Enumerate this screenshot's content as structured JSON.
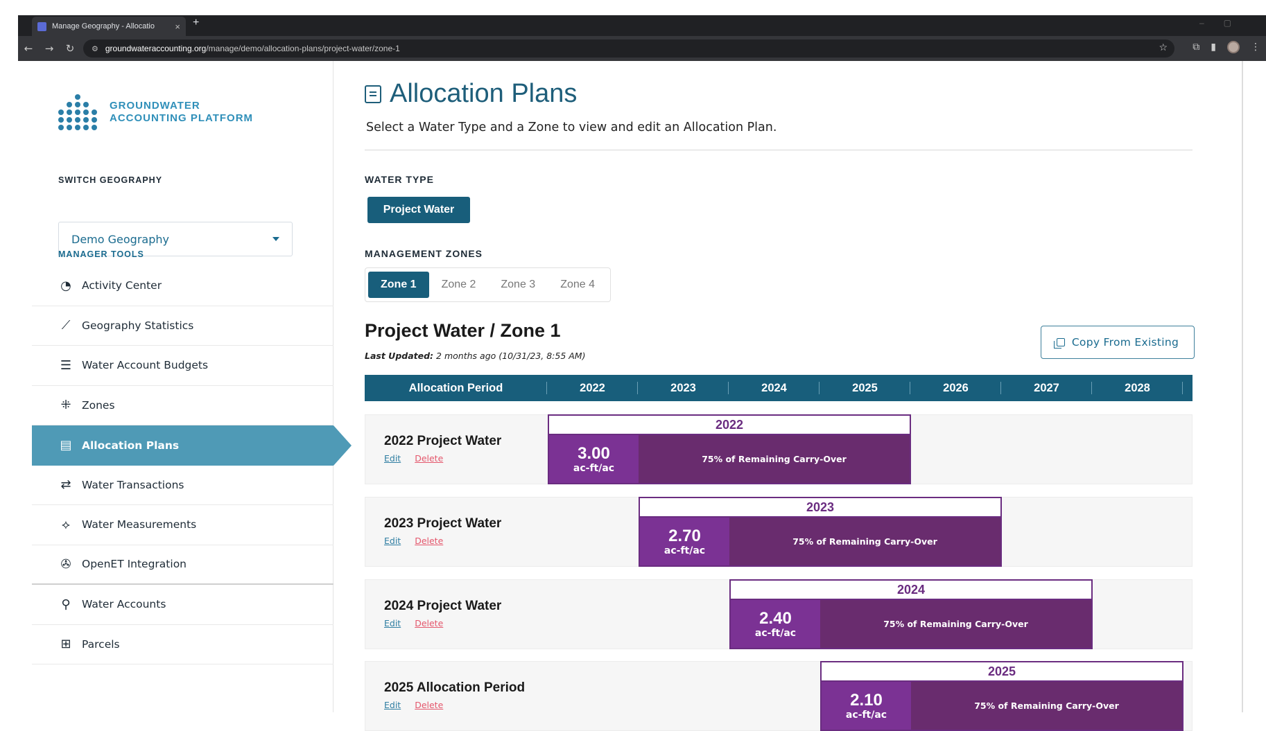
{
  "browser": {
    "tab_title": "Manage Geography - Allocatio",
    "tab_close": "×",
    "new_tab": "+",
    "url_host": "groundwateraccounting.org",
    "url_path": "/manage/demo/allocation-plans/project-water/zone-1"
  },
  "sidebar": {
    "logo_line1": "GROUNDWATER",
    "logo_line2": "ACCOUNTING PLATFORM",
    "switch_label": "SWITCH GEOGRAPHY",
    "geography_value": "Demo Geography",
    "manager_tools_label": "MANAGER TOOLS",
    "items": [
      {
        "label": "Activity Center",
        "icon": "gauge-icon"
      },
      {
        "label": "Geography Statistics",
        "icon": "line-chart-icon"
      },
      {
        "label": "Water Account Budgets",
        "icon": "budget-list-icon"
      },
      {
        "label": "Zones",
        "icon": "zones-icon"
      },
      {
        "label": "Allocation Plans",
        "icon": "allocation-plan-icon",
        "active": true
      },
      {
        "label": "Water Transactions",
        "icon": "transfer-arrows-icon"
      },
      {
        "label": "Water Measurements",
        "icon": "ruler-icon"
      },
      {
        "label": "OpenET Integration",
        "icon": "satellite-icon"
      },
      {
        "label": "Water Accounts",
        "icon": "irrigation-icon"
      },
      {
        "label": "Parcels",
        "icon": "grid-icon"
      }
    ]
  },
  "main": {
    "title": "Allocation Plans",
    "subtitle": "Select a Water Type and a Zone to view and edit an Allocation Plan.",
    "water_type_label": "WATER TYPE",
    "water_type_selected": "Project Water",
    "management_zones_label": "MANAGEMENT ZONES",
    "zones": [
      "Zone 1",
      "Zone 2",
      "Zone 3",
      "Zone 4"
    ],
    "selected_zone": "Zone 1",
    "plan_title": "Project Water / Zone 1",
    "last_updated_label": "Last Updated:",
    "last_updated_value": "2 months ago (10/31/23, 8:55 AM)",
    "copy_button": "Copy From Existing",
    "timeline_header": {
      "period_label": "Allocation Period",
      "years": [
        "2022",
        "2023",
        "2024",
        "2025",
        "2026",
        "2027",
        "2028"
      ]
    },
    "rows": [
      {
        "title": "2022 Project Water",
        "edit": "Edit",
        "delete": "Delete",
        "year": "2022",
        "value": "3.00",
        "unit": "ac-ft/ac",
        "carryover": "75% of Remaining Carry-Over"
      },
      {
        "title": "2023 Project Water",
        "edit": "Edit",
        "delete": "Delete",
        "year": "2023",
        "value": "2.70",
        "unit": "ac-ft/ac",
        "carryover": "75% of Remaining Carry-Over"
      },
      {
        "title": "2024 Project Water",
        "edit": "Edit",
        "delete": "Delete",
        "year": "2024",
        "value": "2.40",
        "unit": "ac-ft/ac",
        "carryover": "75% of Remaining Carry-Over"
      },
      {
        "title": "2025 Allocation Period",
        "edit": "Edit",
        "delete": "Delete",
        "year": "2025",
        "value": "2.10",
        "unit": "ac-ft/ac",
        "carryover": "75% of Remaining Carry-Over"
      }
    ]
  },
  "colors": {
    "primary": "#185e7b",
    "sidebar_active": "#4f9ab6",
    "allocation_purple": "#7b3294",
    "carryover_purple": "#692c6e",
    "delete_red": "#e4576c"
  }
}
